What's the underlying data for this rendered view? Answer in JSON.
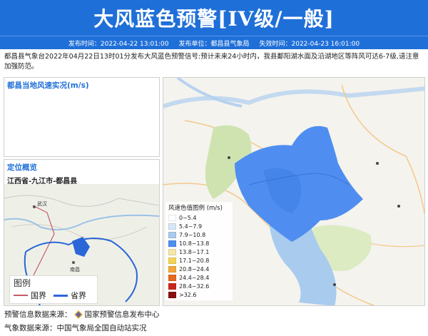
{
  "title": "大风蓝色预警[IV级/一般]",
  "meta": {
    "issue_time": "发布时间：2022-04-22 13:01:00",
    "issuer": "发布单位：都昌县气象局",
    "expire_time": "失效时间：2022-04-23 16:01:00"
  },
  "description": "都昌县气象台2022年04月22日13时01分发布大风蓝色预警信号:预计未来24小时内，我县鄱阳湖水面及沿湖地区等阵风可达6-7级,请注意加强防范。",
  "wind_panel": {
    "title": "都昌当地风速实况(m/s)"
  },
  "location_panel": {
    "title": "定位概览",
    "path": "江西省-九江市-都昌县",
    "map_labels": [
      "武汉",
      "南昌"
    ]
  },
  "inset_legend": {
    "title": "图例",
    "items": [
      {
        "label": "国界",
        "color": "#c85a66"
      },
      {
        "label": "省界",
        "color": "#2b66d9"
      }
    ]
  },
  "legend": {
    "title": "风速色值图例 (m/s)",
    "items": [
      {
        "label": "0~5.4",
        "color": "#ffffff"
      },
      {
        "label": "5.4~7.9",
        "color": "#d6e8f7"
      },
      {
        "label": "7.9~10.8",
        "color": "#a9cbee"
      },
      {
        "label": "10.8~13.8",
        "color": "#4f8ef0"
      },
      {
        "label": "13.8~17.1",
        "color": "#f7e7a8"
      },
      {
        "label": "17.1~20.8",
        "color": "#f5d45a"
      },
      {
        "label": "20.8~24.4",
        "color": "#f2a73a"
      },
      {
        "label": "24.4~28.4",
        "color": "#e8671f"
      },
      {
        "label": "28.4~32.6",
        "color": "#c8261a"
      },
      {
        "label": ">32.6",
        "color": "#8b0f10"
      }
    ]
  },
  "sources": {
    "warning_source_label": "预警信息数据来源：",
    "warning_source": "国家预警信息发布中心",
    "weather_source": "气象数据来源：中国气象局全国自动站实况"
  },
  "colors": {
    "brand": "#1f6fd8"
  }
}
